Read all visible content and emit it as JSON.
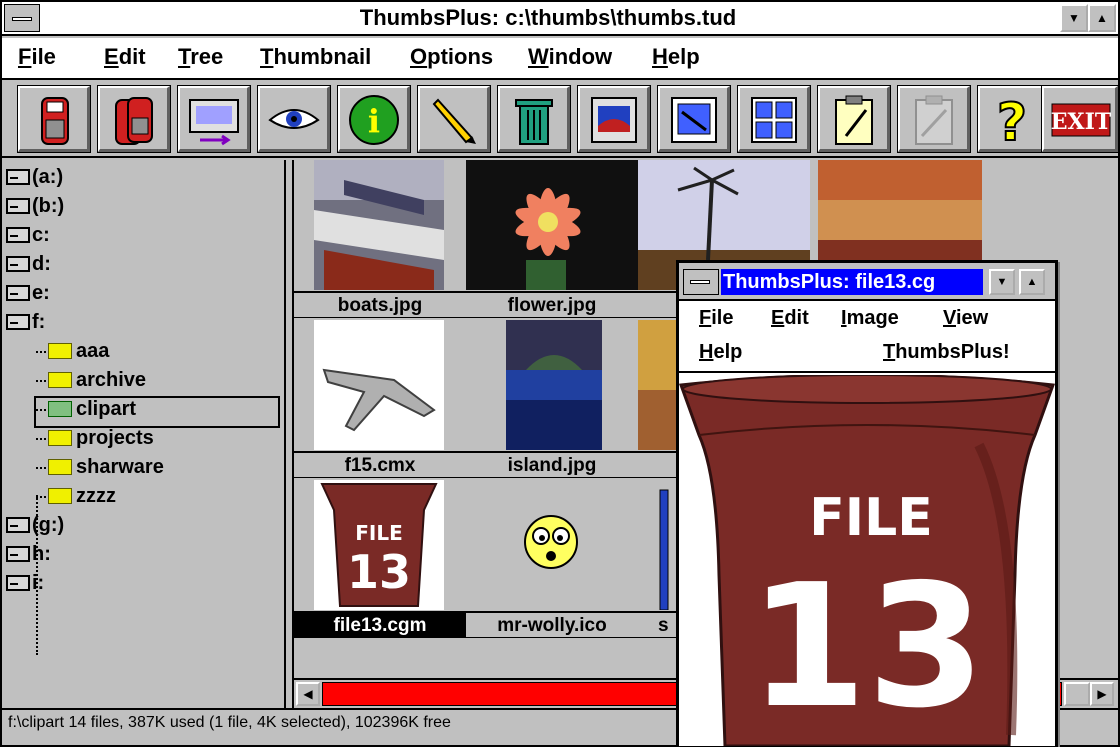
{
  "window": {
    "title": "ThumbsPlus: c:\\thumbs\\thumbs.tud",
    "minimize_icon": "triangle-down-icon",
    "maximize_icon": "triangle-up-icon"
  },
  "menu": {
    "items": [
      "File",
      "Edit",
      "Tree",
      "Thumbnail",
      "Options",
      "Window",
      "Help"
    ]
  },
  "toolbar": {
    "buttons": [
      "floppy-disk-icon",
      "floppy-disks-icon",
      "monitor-arrow-icon",
      "eye-icon",
      "info-icon",
      "pencil-icon",
      "trash-can-icon",
      "display-icon",
      "grid-one-icon",
      "grid-many-icon",
      "clipboard-icon",
      "clipboard-disabled-icon",
      "help-icon",
      "exit-icon"
    ],
    "exit_label": "EXIT"
  },
  "tree": {
    "items": [
      {
        "label": "(a:)",
        "type": "drive"
      },
      {
        "label": "(b:)",
        "type": "drive"
      },
      {
        "label": "c:",
        "type": "drive"
      },
      {
        "label": "d:",
        "type": "drive"
      },
      {
        "label": "e:",
        "type": "drive"
      },
      {
        "label": "f:",
        "type": "drive"
      },
      {
        "label": "aaa",
        "type": "folder"
      },
      {
        "label": "archive",
        "type": "folder"
      },
      {
        "label": "clipart",
        "type": "folder",
        "selected": true
      },
      {
        "label": "projects",
        "type": "folder"
      },
      {
        "label": "sharware",
        "type": "folder"
      },
      {
        "label": "zzzz",
        "type": "folder"
      },
      {
        "label": "(g:)",
        "type": "drive"
      },
      {
        "label": "h:",
        "type": "drive"
      },
      {
        "label": "i:",
        "type": "drive"
      }
    ]
  },
  "thumbnails": {
    "items": [
      {
        "name": "boats.jpg"
      },
      {
        "name": "flower.jpg"
      },
      {
        "name": ""
      },
      {
        "name": ""
      },
      {
        "name": "f15.cmx"
      },
      {
        "name": "island.jpg"
      },
      {
        "name": ""
      },
      {
        "name": "file13.cgm",
        "selected": true
      },
      {
        "name": "mr-wolly.ico"
      },
      {
        "name": "s"
      }
    ]
  },
  "status": {
    "text": "f:\\clipart 14 files, 387K used (1 file, 4K selected), 102396K free"
  },
  "viewer": {
    "title": "ThumbsPlus: file13.cg",
    "menu": [
      "File",
      "Edit",
      "Image",
      "View",
      "Help",
      "ThumbsPlus!"
    ],
    "image_text_line1": "FILE",
    "image_text_line2": "13"
  },
  "colors": {
    "titlebar_active": "#0000ff",
    "scrollbar_track": "#ff0000",
    "bin": "#7a2a26",
    "face": "#c0c0c0"
  }
}
